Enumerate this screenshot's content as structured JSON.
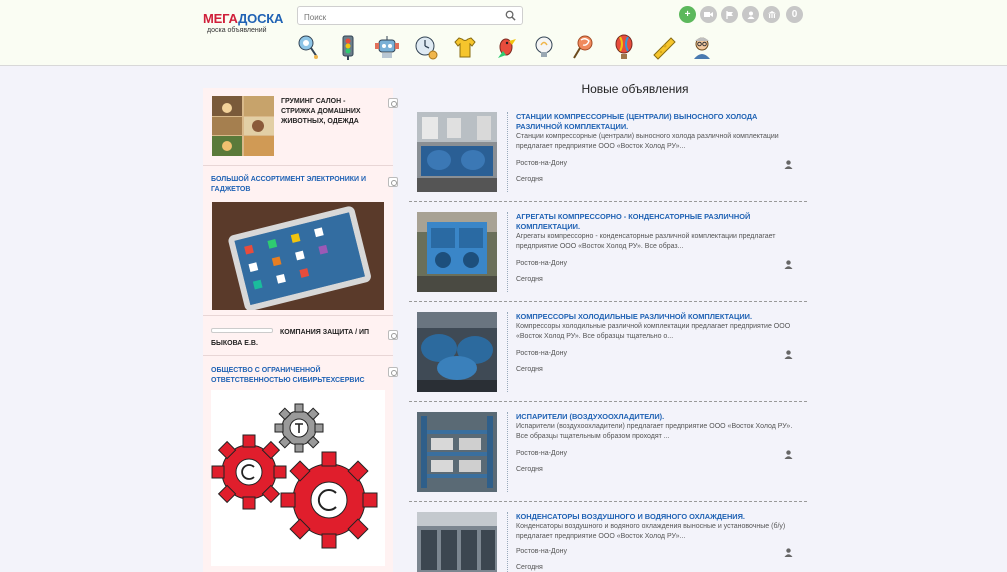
{
  "header": {
    "logo_mega": "МЕГА",
    "logo_doska": "ДОСКА",
    "logo_sub": "доска объявлений",
    "search_placeholder": "Поиск",
    "categories": [
      {
        "name": "children-icon"
      },
      {
        "name": "traffic-light-icon"
      },
      {
        "name": "robot-icon"
      },
      {
        "name": "clock-money-icon"
      },
      {
        "name": "tshirt-icon"
      },
      {
        "name": "parrot-icon"
      },
      {
        "name": "lightbulb-icon"
      },
      {
        "name": "lollipop-icon"
      },
      {
        "name": "balloon-icon"
      },
      {
        "name": "cheese-icon"
      },
      {
        "name": "professor-icon"
      }
    ],
    "actions": {
      "add": "+",
      "counter": "0"
    }
  },
  "sidebar": {
    "cards": [
      {
        "title": "ГРУМИНГ САЛОН - СТРИЖКА ДОМАШНИХ ЖИВОТНЫХ, ОДЕЖДА"
      },
      {
        "title": "БОЛЬШОЙ АССОРТИМЕНТ ЭЛЕКТРОНИКИ И ГАДЖЕТОВ"
      },
      {
        "title_1": "КОМПАНИЯ ЗАЩИТА / ИП",
        "title_2": "БЫКОВА Е.В."
      },
      {
        "title": "ОБЩЕСТВО С ОГРАНИЧЕННОЙ ОТВЕТСТВЕННОСТЬЮ СИБИРЬТЕХСЕРВИС"
      }
    ]
  },
  "main": {
    "title": "Новые объявления",
    "items": [
      {
        "title": "СТАНЦИИ КОМПРЕССОРНЫЕ (ЦЕНТРАЛИ) ВЫНОСНОГО ХОЛОДА РАЗЛИЧНОЙ КОМПЛЕКТАЦИИ.",
        "desc": "Станции компрессорные (централи) выносного холода различной комплектации предлагает предприятие ООО «Восток Холод РУ»...",
        "city": "Ростов-на-Дону",
        "date": "Сегодня"
      },
      {
        "title": "АГРЕГАТЫ КОМПРЕССОРНО - КОНДЕНСАТОРНЫЕ РАЗЛИЧНОЙ КОМПЛЕКТАЦИИ.",
        "desc": "Агрегаты компрессорно - конденсаторные различной комплектации предлагает предприятие ООО «Восток Холод РУ». Все образ...",
        "city": "Ростов-на-Дону",
        "date": "Сегодня"
      },
      {
        "title": "КОМПРЕССОРЫ ХОЛОДИЛЬНЫЕ РАЗЛИЧНОЙ КОМПЛЕКТАЦИИ.",
        "desc": "Компрессоры холодильные различной комплектации предлагает предприятие ООО «Восток Холод РУ». Все образцы тщательно о...",
        "city": "Ростов-на-Дону",
        "date": "Сегодня"
      },
      {
        "title": "ИСПАРИТЕЛИ (ВОЗДУХООХЛАДИТЕЛИ).",
        "desc": "Испарители (воздухоохладители) предлагает предприятие ООО «Восток Холод РУ». Все образцы тщательным образом проходят ...",
        "city": "Ростов-на-Дону",
        "date": "Сегодня"
      },
      {
        "title": "КОНДЕНСАТОРЫ ВОЗДУШНОГО И ВОДЯНОГО ОХЛАЖДЕНИЯ.",
        "desc": "Конденсаторы воздушного и водяного охлаждения выносные и установочные (б/у) предлагает предприятие ООО «Восток Холод РУ»...",
        "city": "Ростов-на-Дону",
        "date": "Сегодня"
      }
    ]
  }
}
